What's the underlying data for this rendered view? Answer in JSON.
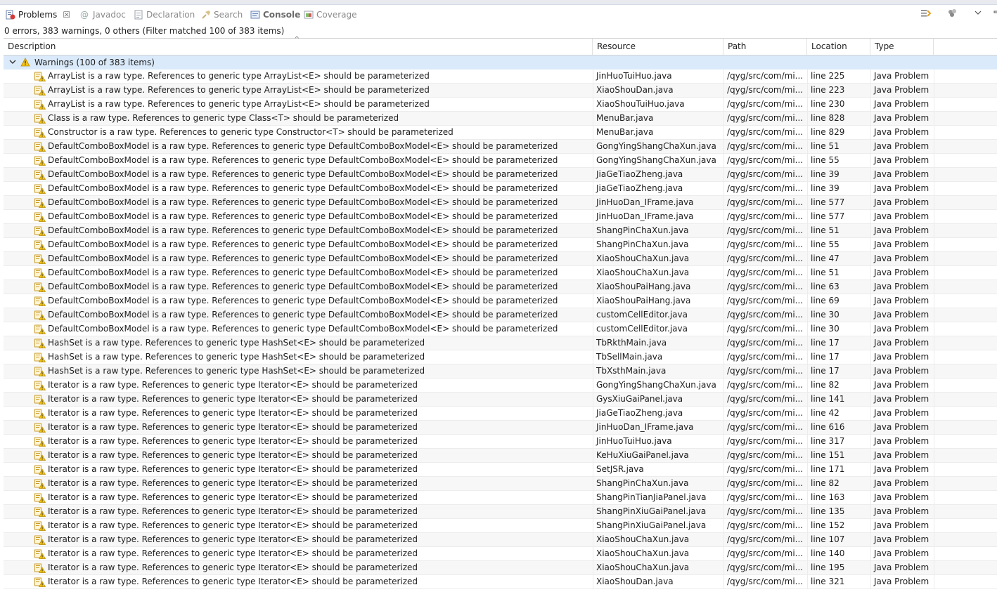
{
  "tabs": [
    {
      "label": "Problems",
      "icon": "problems-icon",
      "active": true,
      "closable": true
    },
    {
      "label": "Javadoc",
      "icon": "javadoc-icon",
      "active": false
    },
    {
      "label": "Declaration",
      "icon": "declaration-icon",
      "active": false
    },
    {
      "label": "Search",
      "icon": "search-icon",
      "active": false
    },
    {
      "label": "Console",
      "icon": "console-icon",
      "active": false,
      "bold": true
    },
    {
      "label": "Coverage",
      "icon": "coverage-icon",
      "active": false
    }
  ],
  "toolbar": {
    "icons": [
      "focus-on-active-task-icon",
      "configure-contents-icon",
      "view-menu-icon",
      "minimize-icon",
      "maximize-icon"
    ]
  },
  "status": "0 errors, 383 warnings, 0 others (Filter matched 100 of 383 items)",
  "columns": {
    "description": "Description",
    "resource": "Resource",
    "path": "Path",
    "location": "Location",
    "type": "Type"
  },
  "group": {
    "label": "Warnings (100 of 383 items)",
    "expanded": true
  },
  "rows": [
    {
      "desc": "ArrayList is a raw type. References to generic type ArrayList<E> should be parameterized",
      "res": "JinHuoTuiHuo.java",
      "path": "/qyg/src/com/mi...",
      "loc": "line 225",
      "type": "Java Problem"
    },
    {
      "desc": "ArrayList is a raw type. References to generic type ArrayList<E> should be parameterized",
      "res": "XiaoShouDan.java",
      "path": "/qyg/src/com/mi...",
      "loc": "line 223",
      "type": "Java Problem"
    },
    {
      "desc": "ArrayList is a raw type. References to generic type ArrayList<E> should be parameterized",
      "res": "XiaoShouTuiHuo.java",
      "path": "/qyg/src/com/mi...",
      "loc": "line 230",
      "type": "Java Problem"
    },
    {
      "desc": "Class is a raw type. References to generic type Class<T> should be parameterized",
      "res": "MenuBar.java",
      "path": "/qyg/src/com/mi...",
      "loc": "line 828",
      "type": "Java Problem"
    },
    {
      "desc": "Constructor is a raw type. References to generic type Constructor<T> should be parameterized",
      "res": "MenuBar.java",
      "path": "/qyg/src/com/mi...",
      "loc": "line 829",
      "type": "Java Problem"
    },
    {
      "desc": "DefaultComboBoxModel is a raw type. References to generic type DefaultComboBoxModel<E> should be parameterized",
      "res": "GongYingShangChaXun.java",
      "path": "/qyg/src/com/mi...",
      "loc": "line 51",
      "type": "Java Problem"
    },
    {
      "desc": "DefaultComboBoxModel is a raw type. References to generic type DefaultComboBoxModel<E> should be parameterized",
      "res": "GongYingShangChaXun.java",
      "path": "/qyg/src/com/mi...",
      "loc": "line 55",
      "type": "Java Problem"
    },
    {
      "desc": "DefaultComboBoxModel is a raw type. References to generic type DefaultComboBoxModel<E> should be parameterized",
      "res": "JiaGeTiaoZheng.java",
      "path": "/qyg/src/com/mi...",
      "loc": "line 39",
      "type": "Java Problem"
    },
    {
      "desc": "DefaultComboBoxModel is a raw type. References to generic type DefaultComboBoxModel<E> should be parameterized",
      "res": "JiaGeTiaoZheng.java",
      "path": "/qyg/src/com/mi...",
      "loc": "line 39",
      "type": "Java Problem"
    },
    {
      "desc": "DefaultComboBoxModel is a raw type. References to generic type DefaultComboBoxModel<E> should be parameterized",
      "res": "JinHuoDan_IFrame.java",
      "path": "/qyg/src/com/mi...",
      "loc": "line 577",
      "type": "Java Problem"
    },
    {
      "desc": "DefaultComboBoxModel is a raw type. References to generic type DefaultComboBoxModel<E> should be parameterized",
      "res": "JinHuoDan_IFrame.java",
      "path": "/qyg/src/com/mi...",
      "loc": "line 577",
      "type": "Java Problem"
    },
    {
      "desc": "DefaultComboBoxModel is a raw type. References to generic type DefaultComboBoxModel<E> should be parameterized",
      "res": "ShangPinChaXun.java",
      "path": "/qyg/src/com/mi...",
      "loc": "line 51",
      "type": "Java Problem"
    },
    {
      "desc": "DefaultComboBoxModel is a raw type. References to generic type DefaultComboBoxModel<E> should be parameterized",
      "res": "ShangPinChaXun.java",
      "path": "/qyg/src/com/mi...",
      "loc": "line 55",
      "type": "Java Problem"
    },
    {
      "desc": "DefaultComboBoxModel is a raw type. References to generic type DefaultComboBoxModel<E> should be parameterized",
      "res": "XiaoShouChaXun.java",
      "path": "/qyg/src/com/mi...",
      "loc": "line 47",
      "type": "Java Problem"
    },
    {
      "desc": "DefaultComboBoxModel is a raw type. References to generic type DefaultComboBoxModel<E> should be parameterized",
      "res": "XiaoShouChaXun.java",
      "path": "/qyg/src/com/mi...",
      "loc": "line 51",
      "type": "Java Problem"
    },
    {
      "desc": "DefaultComboBoxModel is a raw type. References to generic type DefaultComboBoxModel<E> should be parameterized",
      "res": "XiaoShouPaiHang.java",
      "path": "/qyg/src/com/mi...",
      "loc": "line 63",
      "type": "Java Problem"
    },
    {
      "desc": "DefaultComboBoxModel is a raw type. References to generic type DefaultComboBoxModel<E> should be parameterized",
      "res": "XiaoShouPaiHang.java",
      "path": "/qyg/src/com/mi...",
      "loc": "line 69",
      "type": "Java Problem"
    },
    {
      "desc": "DefaultComboBoxModel is a raw type. References to generic type DefaultComboBoxModel<E> should be parameterized",
      "res": "customCellEditor.java",
      "path": "/qyg/src/com/mi...",
      "loc": "line 30",
      "type": "Java Problem"
    },
    {
      "desc": "DefaultComboBoxModel is a raw type. References to generic type DefaultComboBoxModel<E> should be parameterized",
      "res": "customCellEditor.java",
      "path": "/qyg/src/com/mi...",
      "loc": "line 30",
      "type": "Java Problem"
    },
    {
      "desc": "HashSet is a raw type. References to generic type HashSet<E> should be parameterized",
      "res": "TbRkthMain.java",
      "path": "/qyg/src/com/mi...",
      "loc": "line 17",
      "type": "Java Problem"
    },
    {
      "desc": "HashSet is a raw type. References to generic type HashSet<E> should be parameterized",
      "res": "TbSellMain.java",
      "path": "/qyg/src/com/mi...",
      "loc": "line 17",
      "type": "Java Problem"
    },
    {
      "desc": "HashSet is a raw type. References to generic type HashSet<E> should be parameterized",
      "res": "TbXsthMain.java",
      "path": "/qyg/src/com/mi...",
      "loc": "line 17",
      "type": "Java Problem"
    },
    {
      "desc": "Iterator is a raw type. References to generic type Iterator<E> should be parameterized",
      "res": "GongYingShangChaXun.java",
      "path": "/qyg/src/com/mi...",
      "loc": "line 82",
      "type": "Java Problem"
    },
    {
      "desc": "Iterator is a raw type. References to generic type Iterator<E> should be parameterized",
      "res": "GysXiuGaiPanel.java",
      "path": "/qyg/src/com/mi...",
      "loc": "line 141",
      "type": "Java Problem"
    },
    {
      "desc": "Iterator is a raw type. References to generic type Iterator<E> should be parameterized",
      "res": "JiaGeTiaoZheng.java",
      "path": "/qyg/src/com/mi...",
      "loc": "line 42",
      "type": "Java Problem"
    },
    {
      "desc": "Iterator is a raw type. References to generic type Iterator<E> should be parameterized",
      "res": "JinHuoDan_IFrame.java",
      "path": "/qyg/src/com/mi...",
      "loc": "line 616",
      "type": "Java Problem"
    },
    {
      "desc": "Iterator is a raw type. References to generic type Iterator<E> should be parameterized",
      "res": "JinHuoTuiHuo.java",
      "path": "/qyg/src/com/mi...",
      "loc": "line 317",
      "type": "Java Problem"
    },
    {
      "desc": "Iterator is a raw type. References to generic type Iterator<E> should be parameterized",
      "res": "KeHuXiuGaiPanel.java",
      "path": "/qyg/src/com/mi...",
      "loc": "line 151",
      "type": "Java Problem"
    },
    {
      "desc": "Iterator is a raw type. References to generic type Iterator<E> should be parameterized",
      "res": "SetJSR.java",
      "path": "/qyg/src/com/mi...",
      "loc": "line 171",
      "type": "Java Problem"
    },
    {
      "desc": "Iterator is a raw type. References to generic type Iterator<E> should be parameterized",
      "res": "ShangPinChaXun.java",
      "path": "/qyg/src/com/mi...",
      "loc": "line 82",
      "type": "Java Problem"
    },
    {
      "desc": "Iterator is a raw type. References to generic type Iterator<E> should be parameterized",
      "res": "ShangPinTianJiaPanel.java",
      "path": "/qyg/src/com/mi...",
      "loc": "line 163",
      "type": "Java Problem"
    },
    {
      "desc": "Iterator is a raw type. References to generic type Iterator<E> should be parameterized",
      "res": "ShangPinXiuGaiPanel.java",
      "path": "/qyg/src/com/mi...",
      "loc": "line 135",
      "type": "Java Problem"
    },
    {
      "desc": "Iterator is a raw type. References to generic type Iterator<E> should be parameterized",
      "res": "ShangPinXiuGaiPanel.java",
      "path": "/qyg/src/com/mi...",
      "loc": "line 152",
      "type": "Java Problem"
    },
    {
      "desc": "Iterator is a raw type. References to generic type Iterator<E> should be parameterized",
      "res": "XiaoShouChaXun.java",
      "path": "/qyg/src/com/mi...",
      "loc": "line 107",
      "type": "Java Problem"
    },
    {
      "desc": "Iterator is a raw type. References to generic type Iterator<E> should be parameterized",
      "res": "XiaoShouChaXun.java",
      "path": "/qyg/src/com/mi...",
      "loc": "line 140",
      "type": "Java Problem"
    },
    {
      "desc": "Iterator is a raw type. References to generic type Iterator<E> should be parameterized",
      "res": "XiaoShouChaXun.java",
      "path": "/qyg/src/com/mi...",
      "loc": "line 195",
      "type": "Java Problem"
    },
    {
      "desc": "Iterator is a raw type. References to generic type Iterator<E> should be parameterized",
      "res": "XiaoShouDan.java",
      "path": "/qyg/src/com/mi...",
      "loc": "line 321",
      "type": "Java Problem"
    }
  ],
  "colors": {
    "group_bg": "#dbeafa",
    "warning_yellow": "#f5c518",
    "active_tab_text": "#1e1e1e",
    "inactive_tab_text": "#8a8a8a"
  }
}
